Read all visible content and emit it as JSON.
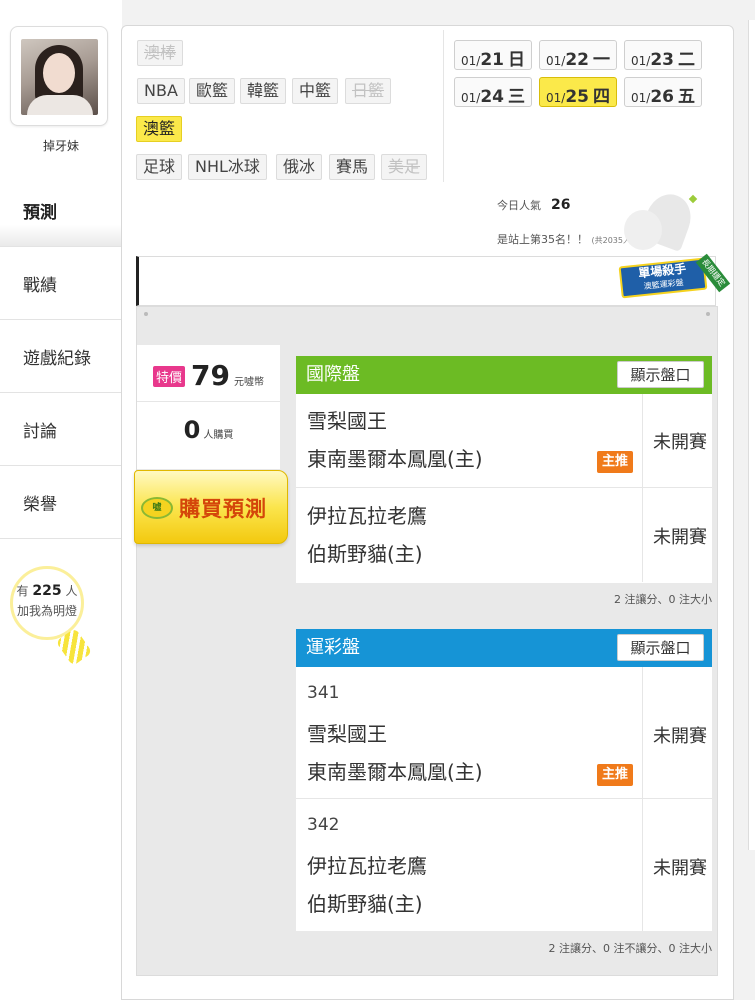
{
  "profile": {
    "username": "掉牙妹",
    "fans_count": "225",
    "fans_prefix": "有",
    "fans_suffix": "人",
    "fans_line2": "加我為明燈"
  },
  "nav": {
    "items": [
      {
        "label": "預測",
        "active": true
      },
      {
        "label": "戰績",
        "active": false
      },
      {
        "label": "遊戲紀錄",
        "active": false
      },
      {
        "label": "討論",
        "active": false
      },
      {
        "label": "榮譽",
        "active": false
      }
    ]
  },
  "leagues": {
    "row1": [
      {
        "label": "澳棒",
        "state": "disabled"
      }
    ],
    "row2": [
      {
        "label": "NBA",
        "state": "normal"
      },
      {
        "label": "歐籃",
        "state": "normal"
      },
      {
        "label": "韓籃",
        "state": "normal"
      },
      {
        "label": "中籃",
        "state": "normal"
      },
      {
        "label": "日籃",
        "state": "disabled"
      }
    ],
    "row3": [
      {
        "label": "澳籃",
        "state": "selected"
      }
    ],
    "row4": [
      {
        "label": "足球",
        "state": "normal"
      },
      {
        "label": "NHL冰球",
        "state": "normal"
      },
      {
        "label": "俄冰",
        "state": "normal"
      },
      {
        "label": "賽馬",
        "state": "normal"
      },
      {
        "label": "美足",
        "state": "disabled"
      }
    ]
  },
  "dates": [
    {
      "md": "01/",
      "d": "21",
      "wd": "日",
      "selected": false
    },
    {
      "md": "01/",
      "d": "22",
      "wd": "一",
      "selected": false
    },
    {
      "md": "01/",
      "d": "23",
      "wd": "二",
      "selected": false
    },
    {
      "md": "01/",
      "d": "24",
      "wd": "三",
      "selected": false
    },
    {
      "md": "01/",
      "d": "25",
      "wd": "四",
      "selected": true
    },
    {
      "md": "01/",
      "d": "26",
      "wd": "五",
      "selected": false
    }
  ],
  "stats": {
    "popularity_label": "今日人氣",
    "popularity_value": "26",
    "rank_text": "是站上第35名！！",
    "rank_total": "(共2035人)"
  },
  "badge": {
    "title": "單場殺手",
    "subtitle": "澳籃運彩盤",
    "tag": "長期穩定"
  },
  "purchase": {
    "tag": "特價",
    "price": "79",
    "unit": "元噓幣",
    "buyers": "0",
    "buyers_unit": "人購買",
    "button_label": "購買預測",
    "coin_label": "噓"
  },
  "intl_box": {
    "title": "國際盤",
    "show_button": "顯示盤口",
    "matches": [
      {
        "team1": "雪梨國王",
        "team2": "東南墨爾本鳳凰(主)",
        "status": "未開賽",
        "pick": "主推"
      },
      {
        "team1": "伊拉瓦拉老鷹",
        "team2": "伯斯野貓(主)",
        "status": "未開賽",
        "pick": ""
      }
    ],
    "footer": "2 注讓分、0 注大小"
  },
  "sport_box": {
    "title": "運彩盤",
    "show_button": "顯示盤口",
    "matches": [
      {
        "num": "341",
        "team1": "雪梨國王",
        "team2": "東南墨爾本鳳凰(主)",
        "status": "未開賽",
        "pick": "主推"
      },
      {
        "num": "342",
        "team1": "伊拉瓦拉老鷹",
        "team2": "伯斯野貓(主)",
        "status": "未開賽",
        "pick": ""
      }
    ],
    "footer": "2 注讓分、0 注不讓分、0 注大小"
  }
}
